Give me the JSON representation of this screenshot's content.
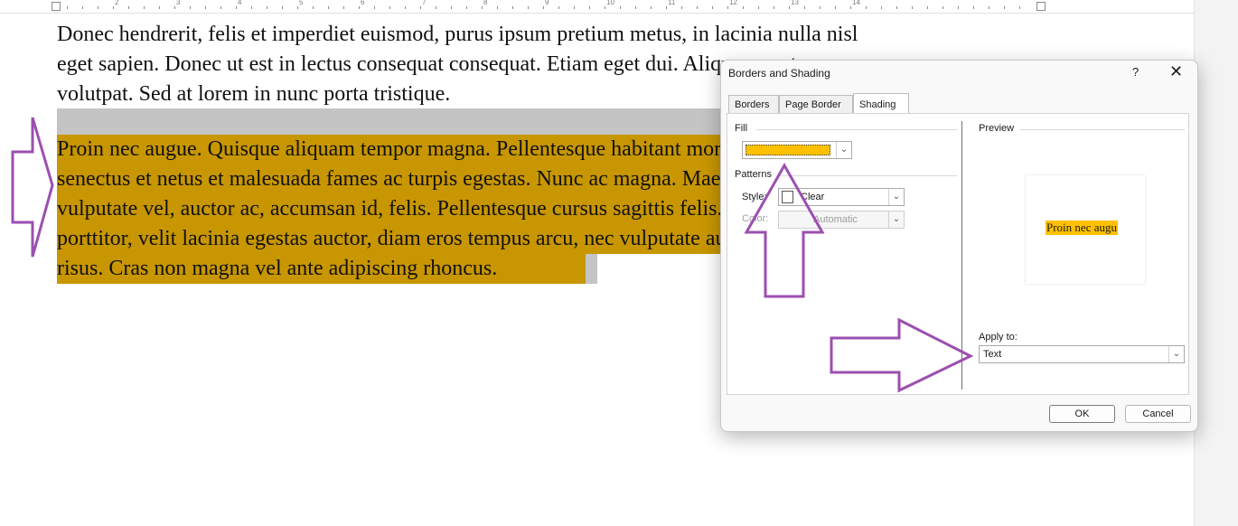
{
  "document": {
    "lines": [
      "Donec hendrerit, felis et imperdiet euismod, purus ipsum pretium metus, in lacinia nulla nisl",
      "eget sapien. Donec ut est in lectus consequat consequat. Etiam eget dui. Aliquam erat",
      "volutpat. Sed at lorem in nunc porta tristique."
    ],
    "shaded_lines": [
      "Proin nec augue. Quisque aliquam tempor magna. Pellentesque habitant morbi tristique",
      "senectus et netus et malesuada fames ac turpis egestas. Nunc ac magna. Maecenas odio dolor,",
      "vulputate vel, auctor ac, accumsan id, felis. Pellentesque cursus sagittis felis. Pellentesque",
      "porttitor, velit lacinia egestas auctor, diam eros tempus arcu, nec vulputate augue magna vel",
      "risus. Cras non magna vel ante adipiscing rhoncus."
    ],
    "shade_color": "#c89600"
  },
  "ruler": {
    "numbers": [
      "2",
      "3",
      "4",
      "5",
      "6",
      "7",
      "8",
      "9",
      "10",
      "11",
      "12",
      "13",
      "14"
    ]
  },
  "dialog": {
    "title": "Borders and Shading",
    "help": "?",
    "close": "✕",
    "tabs": [
      {
        "label": "Borders",
        "active": false
      },
      {
        "label": "Page Border",
        "active": false
      },
      {
        "label": "Shading",
        "active": true
      }
    ],
    "fill": {
      "label": "Fill",
      "color": "#ffc000"
    },
    "patterns": {
      "label": "Patterns",
      "style_label": "Style:",
      "style_value": "Clear",
      "color_label": "Color:",
      "color_value": "Automatic"
    },
    "preview": {
      "label": "Preview",
      "text": "Proin nec augu"
    },
    "apply_to": {
      "label": "Apply to:",
      "value": "Text"
    },
    "ok_label": "OK",
    "cancel_label": "Cancel"
  },
  "annotation_color": "#9b4fb0"
}
